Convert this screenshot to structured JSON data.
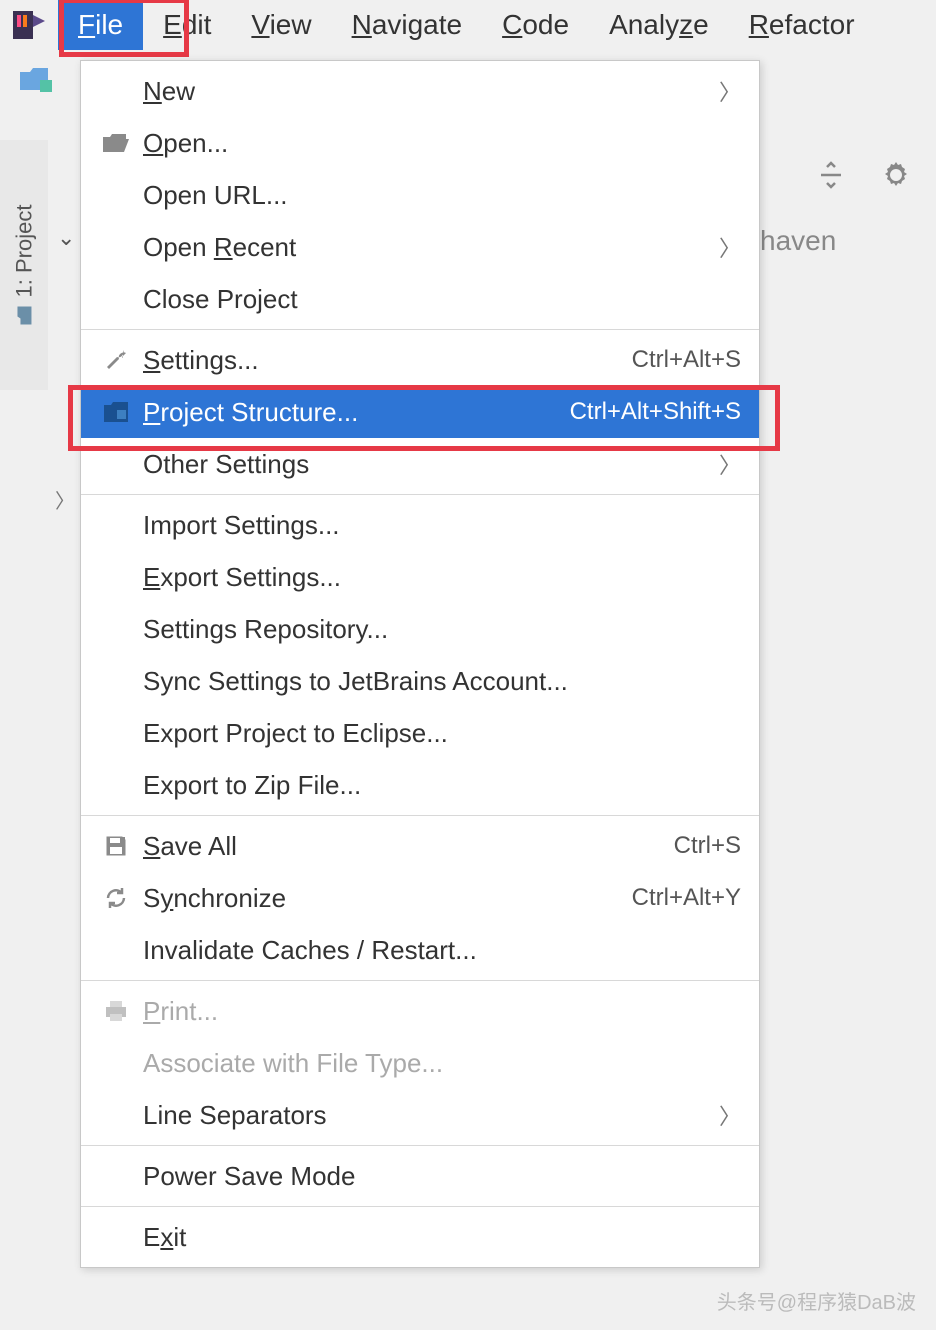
{
  "menubar": {
    "items": [
      {
        "label": "File",
        "mnemonic": "F",
        "active": true
      },
      {
        "label": "Edit",
        "mnemonic": "E"
      },
      {
        "label": "View",
        "mnemonic": "V"
      },
      {
        "label": "Navigate",
        "mnemonic": "N"
      },
      {
        "label": "Code",
        "mnemonic": "C"
      },
      {
        "label": "Analyze",
        "mnemonic": "z"
      },
      {
        "label": "Refactor",
        "mnemonic": "R"
      }
    ]
  },
  "sidebar": {
    "project_label": "1: Project"
  },
  "background": {
    "text_fragment": "haven"
  },
  "dropdown": {
    "groups": [
      [
        {
          "label": "New",
          "mnemonic": "N",
          "submenu": true,
          "icon": null
        },
        {
          "label": "Open...",
          "mnemonic": "O",
          "icon": "folder-open"
        },
        {
          "label": "Open URL...",
          "icon": null
        },
        {
          "label": "Open Recent",
          "mnemonic": "R",
          "submenu": true,
          "icon": null
        },
        {
          "label": "Close Project",
          "icon": null
        }
      ],
      [
        {
          "label": "Settings...",
          "mnemonic": "S",
          "shortcut": "Ctrl+Alt+S",
          "icon": "wrench"
        },
        {
          "label": "Project Structure...",
          "mnemonic": "P",
          "shortcut": "Ctrl+Alt+Shift+S",
          "icon": "project-structure",
          "selected": true
        },
        {
          "label": "Other Settings",
          "submenu": true,
          "icon": null
        }
      ],
      [
        {
          "label": "Import Settings...",
          "icon": null
        },
        {
          "label": "Export Settings...",
          "mnemonic": "E",
          "icon": null
        },
        {
          "label": "Settings Repository...",
          "icon": null
        },
        {
          "label": "Sync Settings to JetBrains Account...",
          "icon": null
        },
        {
          "label": "Export Project to Eclipse...",
          "icon": null
        },
        {
          "label": "Export to Zip File...",
          "icon": null
        }
      ],
      [
        {
          "label": "Save All",
          "mnemonic": "S",
          "shortcut": "Ctrl+S",
          "icon": "save"
        },
        {
          "label": "Synchronize",
          "mnemonic": "y",
          "shortcut": "Ctrl+Alt+Y",
          "icon": "sync"
        },
        {
          "label": "Invalidate Caches / Restart...",
          "icon": null
        }
      ],
      [
        {
          "label": "Print...",
          "mnemonic": "P",
          "icon": "print",
          "disabled": true
        },
        {
          "label": "Associate with File Type...",
          "icon": null,
          "disabled": true
        },
        {
          "label": "Line Separators",
          "submenu": true,
          "icon": null
        }
      ],
      [
        {
          "label": "Power Save Mode",
          "icon": null
        }
      ],
      [
        {
          "label": "Exit",
          "mnemonic": "x",
          "icon": null
        }
      ]
    ]
  },
  "watermark": "头条号@程序猿DaB波",
  "colors": {
    "selection": "#2e75d5",
    "highlight_border": "#e63946"
  }
}
